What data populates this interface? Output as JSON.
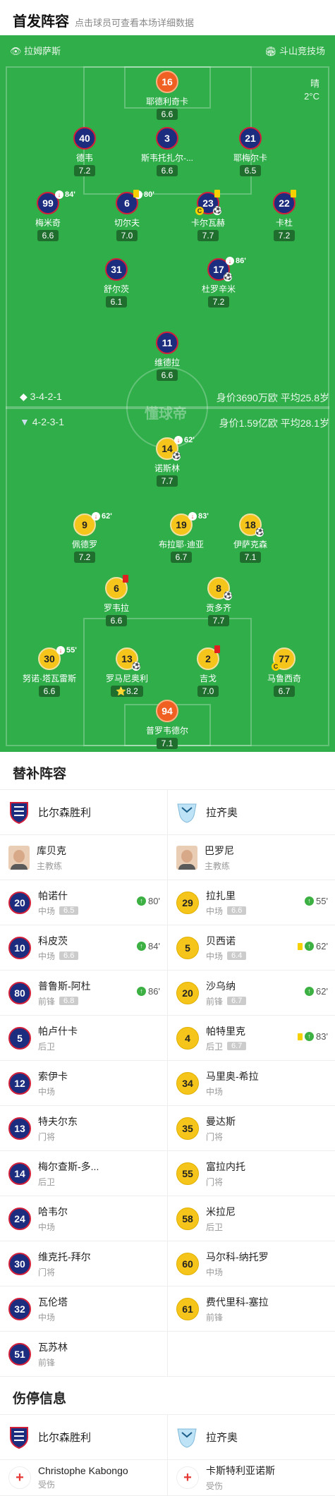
{
  "header": {
    "title": "首发阵容",
    "subtitle": "点击球员可查看本场详细数据"
  },
  "pitch": {
    "home_team": "拉姆萨斯",
    "stadium": "斗山竞技场",
    "weather": "晴",
    "temp": "2°C",
    "watermark": "懂球帝",
    "team_a": {
      "formation": "3-4-2-1",
      "info": "身价3690万欧  平均25.8岁"
    },
    "team_b": {
      "formation": "4-2-3-1",
      "info": "身价1.59亿欧  平均28.1岁"
    }
  },
  "players": [
    {
      "num": "16",
      "name": "耶德利奇卡",
      "rating": "6.6",
      "kit": "or"
    },
    {
      "num": "40",
      "name": "德韦",
      "rating": "7.2",
      "kit": "bl"
    },
    {
      "num": "3",
      "name": "斯韦托扎尔-...",
      "rating": "6.6",
      "kit": "bl"
    },
    {
      "num": "21",
      "name": "耶梅尔卡",
      "rating": "6.5",
      "kit": "bl"
    },
    {
      "num": "99",
      "name": "梅米奇",
      "rating": "6.6",
      "kit": "bl",
      "sub": "84'"
    },
    {
      "num": "6",
      "name": "切尔夫",
      "rating": "7.0",
      "kit": "bl",
      "sub": "80'",
      "card": "y"
    },
    {
      "num": "23",
      "name": "卡尔瓦赫",
      "rating": "7.7",
      "kit": "bl",
      "card": "y",
      "cap": "C",
      "goal": "⚽"
    },
    {
      "num": "22",
      "name": "卡杜",
      "rating": "7.2",
      "kit": "bl",
      "card": "y"
    },
    {
      "num": "31",
      "name": "舒尔茨",
      "rating": "6.1",
      "kit": "bl"
    },
    {
      "num": "17",
      "name": "杜罗辛米",
      "rating": "7.2",
      "kit": "bl",
      "sub": "86'",
      "goal": "⚽"
    },
    {
      "num": "11",
      "name": "维德拉",
      "rating": "6.6",
      "kit": "bl"
    },
    {
      "num": "14",
      "name": "诺斯林",
      "rating": "7.7",
      "kit": "ye",
      "sub": "62'",
      "goal": "⚽"
    },
    {
      "num": "9",
      "name": "佩德罗",
      "rating": "7.2",
      "kit": "ye",
      "sub": "62'"
    },
    {
      "num": "19",
      "name": "布拉耶·迪亚",
      "rating": "6.7",
      "kit": "ye",
      "sub": "83'"
    },
    {
      "num": "18",
      "name": "伊萨克森",
      "rating": "7.1",
      "kit": "ye",
      "goal": "⚽"
    },
    {
      "num": "6",
      "name": "罗韦拉",
      "rating": "6.6",
      "kit": "ye",
      "card": "r"
    },
    {
      "num": "8",
      "name": "贡多齐",
      "rating": "7.7",
      "kit": "ye",
      "goal": "⚽"
    },
    {
      "num": "30",
      "name": "努诺·塔瓦雷斯",
      "rating": "6.6",
      "kit": "ye",
      "sub": "55'"
    },
    {
      "num": "13",
      "name": "罗马尼奥利",
      "rating": "⭐8.2",
      "kit": "ye",
      "goal": "⚽"
    },
    {
      "num": "2",
      "name": "吉戈",
      "rating": "7.0",
      "kit": "ye",
      "card": "r"
    },
    {
      "num": "77",
      "name": "马鲁西奇",
      "rating": "6.7",
      "kit": "ye",
      "cap": "C"
    },
    {
      "num": "94",
      "name": "普罗韦德尔",
      "rating": "7.1",
      "kit": "or"
    }
  ],
  "subs": {
    "title": "替补阵容",
    "home_team": "比尔森胜利",
    "away_team": "拉齐奥",
    "home_coach": {
      "name": "库贝克",
      "role": "主教练"
    },
    "away_coach": {
      "name": "巴罗尼",
      "role": "主教练"
    },
    "home": [
      {
        "num": "20",
        "name": "帕诺什",
        "pos": "中场",
        "rating": "6.5",
        "event": "80'"
      },
      {
        "num": "10",
        "name": "科皮茨",
        "pos": "中场",
        "rating": "6.6",
        "event": "84'"
      },
      {
        "num": "80",
        "name": "普鲁斯-阿杜",
        "pos": "前锋",
        "rating": "6.8",
        "event": "86'"
      },
      {
        "num": "5",
        "name": "帕卢什卡",
        "pos": "后卫"
      },
      {
        "num": "12",
        "name": "索伊卡",
        "pos": "中场"
      },
      {
        "num": "13",
        "name": "特夫尔东",
        "pos": "门将"
      },
      {
        "num": "14",
        "name": "梅尔查斯-多...",
        "pos": "后卫"
      },
      {
        "num": "24",
        "name": "哈韦尔",
        "pos": "中场"
      },
      {
        "num": "30",
        "name": "维克托-拜尔",
        "pos": "门将"
      },
      {
        "num": "32",
        "name": "瓦伦塔",
        "pos": "中场"
      },
      {
        "num": "51",
        "name": "瓦苏林",
        "pos": "前锋"
      }
    ],
    "away": [
      {
        "num": "29",
        "name": "拉扎里",
        "pos": "中场",
        "rating": "6.6",
        "event": "55'"
      },
      {
        "num": "5",
        "name": "贝西诺",
        "pos": "中场",
        "rating": "6.4",
        "event": "62'",
        "yellow": true
      },
      {
        "num": "20",
        "name": "沙乌纳",
        "pos": "前锋",
        "rating": "6.7",
        "event": "62'"
      },
      {
        "num": "4",
        "name": "帕特里克",
        "pos": "后卫",
        "rating": "6.7",
        "event": "83'",
        "yellow": true
      },
      {
        "num": "34",
        "name": "马里奥-希拉",
        "pos": "中场"
      },
      {
        "num": "35",
        "name": "曼达斯",
        "pos": "门将"
      },
      {
        "num": "55",
        "name": "富拉内托",
        "pos": "门将"
      },
      {
        "num": "58",
        "name": "米拉尼",
        "pos": "后卫"
      },
      {
        "num": "60",
        "name": "马尔科-纳托罗",
        "pos": "中场"
      },
      {
        "num": "61",
        "name": "费代里科-塞拉",
        "pos": "前锋"
      }
    ]
  },
  "injuries": {
    "title": "伤停信息",
    "home_team": "比尔森胜利",
    "away_team": "拉齐奥",
    "home": [
      {
        "name": "Christophe Kabongo",
        "status": "受伤"
      }
    ],
    "away": [
      {
        "name": "卡斯特利亚诺斯",
        "status": "受伤"
      }
    ]
  },
  "colors": {
    "pitch": "#2fae4a",
    "home_kit": "#1c2c7e",
    "away_kit": "#f6c51b",
    "keeper": "#f06022",
    "accent": "#3cb043"
  }
}
